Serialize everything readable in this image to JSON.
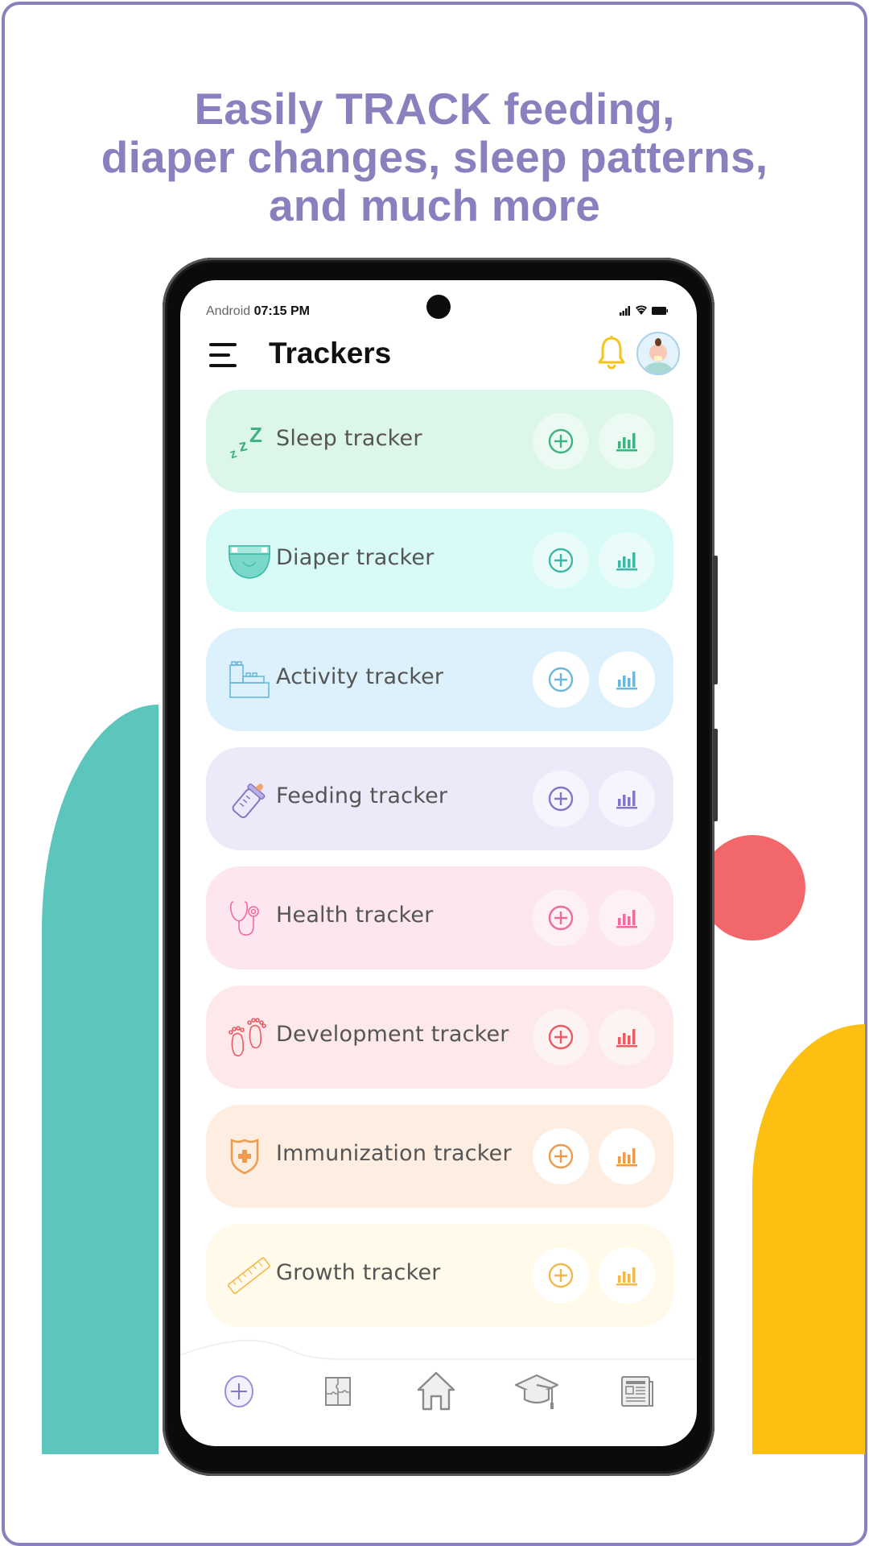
{
  "promo": {
    "headline_line1_pre": "Easily ",
    "headline_line1_bold": "TRACK",
    "headline_line1_post": " feeding,",
    "headline_line2": "diaper changes, sleep patterns,",
    "headline_line3": "and much more",
    "accent_color": "#8a80be"
  },
  "status_bar": {
    "os_label": "Android",
    "time": "07:15 PM",
    "icons": [
      "signal-icon",
      "wifi-icon",
      "battery-icon"
    ]
  },
  "header": {
    "title": "Trackers",
    "menu_icon": "hamburger-menu-icon",
    "notification_icon": "bell-icon",
    "avatar": "baby-avatar"
  },
  "trackers": [
    {
      "label": "Sleep tracker",
      "icon": "zzz-sleep-icon",
      "bg": "#dcf6ea",
      "accent": "#3fb282",
      "btn_bg": "#ebfaf3"
    },
    {
      "label": "Diaper tracker",
      "icon": "diaper-icon",
      "bg": "#d8fbf8",
      "accent": "#3db8a5",
      "btn_bg": "#e9fcfa"
    },
    {
      "label": "Activity tracker",
      "icon": "building-blocks-icon",
      "bg": "#dcf1fc",
      "accent": "#6cb8dc",
      "btn_bg": "#ffffff"
    },
    {
      "label": "Feeding tracker",
      "icon": "baby-bottle-icon",
      "bg": "#ece9f9",
      "accent": "#8475c6",
      "btn_bg": "#f6f4fc"
    },
    {
      "label": "Health tracker",
      "icon": "stethoscope-icon",
      "bg": "#fde6ef",
      "accent": "#f06c9e",
      "btn_bg": "#fdf1f5"
    },
    {
      "label": "Development tracker",
      "icon": "baby-feet-icon",
      "bg": "#fde8ea",
      "accent": "#ec5b62",
      "btn_bg": "#fef3f3"
    },
    {
      "label": "Immunization tracker",
      "icon": "shield-plus-icon",
      "bg": "#feeee2",
      "accent": "#ef9a4a",
      "btn_bg": "#ffffff"
    },
    {
      "label": "Growth tracker",
      "icon": "ruler-icon",
      "bg": "#fffaea",
      "accent": "#f5b84a",
      "btn_bg": "#ffffff"
    }
  ],
  "tracker_actions": {
    "add_icon": "plus-circle-icon",
    "stats_icon": "bar-chart-icon"
  },
  "bottom_nav": [
    {
      "name": "add",
      "icon": "plus-circle-icon",
      "active": true
    },
    {
      "name": "puzzle",
      "icon": "puzzle-icon",
      "active": false
    },
    {
      "name": "home",
      "icon": "home-icon",
      "active": false
    },
    {
      "name": "learn",
      "icon": "graduation-cap-icon",
      "active": false
    },
    {
      "name": "news",
      "icon": "newspaper-icon",
      "active": false
    }
  ],
  "decor_colors": {
    "teal": "#5cc5bc",
    "coral": "#f2676a",
    "yellow": "#fdbf12"
  }
}
